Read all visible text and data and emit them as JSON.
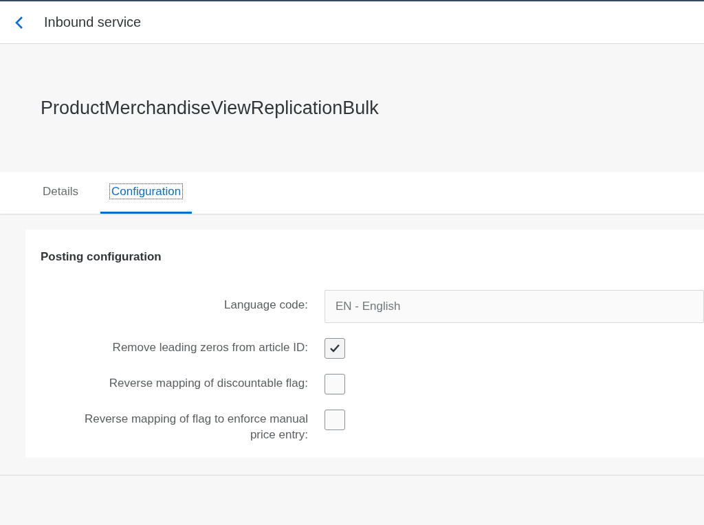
{
  "header": {
    "title": "Inbound service"
  },
  "object_title": "ProductMerchandiseViewReplicationBulk",
  "tabs": [
    {
      "label": "Details",
      "selected": false
    },
    {
      "label": "Configuration",
      "selected": true
    }
  ],
  "section": {
    "title": "Posting configuration",
    "fields": [
      {
        "kind": "input",
        "label": "Language code:",
        "value": "EN - English"
      },
      {
        "kind": "checkbox",
        "label": "Remove leading zeros from article ID:",
        "checked": true
      },
      {
        "kind": "checkbox",
        "label": "Reverse mapping of discountable flag:",
        "checked": false
      },
      {
        "kind": "checkbox",
        "label": "Reverse mapping of flag to enforce manual price entry:",
        "checked": false
      }
    ]
  }
}
